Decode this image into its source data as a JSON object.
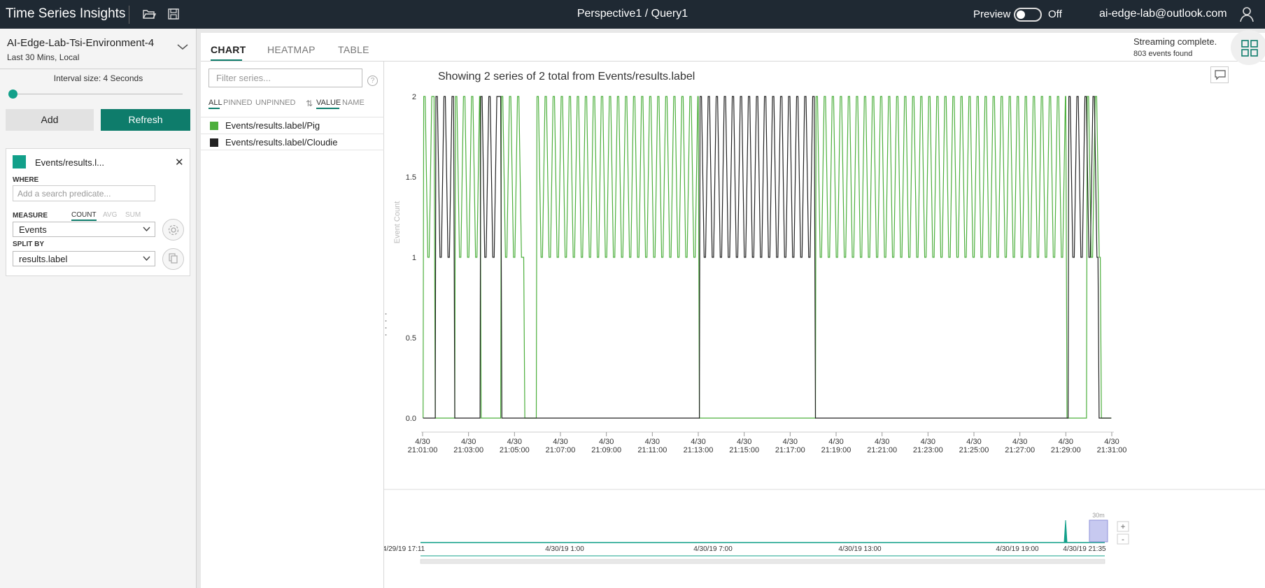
{
  "app": {
    "title": "Time Series Insights"
  },
  "header": {
    "breadcrumb": "Perspective1 / Query1",
    "preview_label": "Preview",
    "toggle_state": "Off",
    "user": "ai-edge-lab@outlook.com",
    "icons": [
      "folder-open-icon",
      "save-icon",
      "user-icon"
    ]
  },
  "left": {
    "environment": "AI-Edge-Lab-Tsi-Environment-4",
    "time_range": "Last 30 Mins, Local",
    "interval": "Interval size: 4 Seconds",
    "add_label": "Add",
    "refresh_label": "Refresh",
    "query": {
      "title": "Events/results.l...",
      "where_label": "WHERE",
      "predicate_placeholder": "Add a search predicate...",
      "measure_label": "MEASURE",
      "measure_tabs": [
        "COUNT",
        "AVG",
        "SUM"
      ],
      "measure_value": "Events",
      "splitby_label": "SPLIT BY",
      "splitby_value": "results.label",
      "color": "#12a08a"
    }
  },
  "main": {
    "tabs": [
      "CHART",
      "HEATMAP",
      "TABLE"
    ],
    "status": "Streaming complete.",
    "events_found": "803 events found",
    "filter_placeholder": "Filter series...",
    "help": "?",
    "filters": [
      "ALL",
      "PINNED",
      "UNPINNED"
    ],
    "sort": [
      "VALUE",
      "NAME"
    ],
    "series": [
      {
        "name": "Events/results.label/Pig",
        "color": "#4caf3c"
      },
      {
        "name": "Events/results.label/Cloudie",
        "color": "#222222"
      }
    ],
    "chart_title": "Showing 2 series of 2 total from Events/results.label"
  },
  "chart_data": {
    "type": "line",
    "ylabel": "Event Count",
    "y_ticks": [
      "2",
      "1.5",
      "1",
      "0.5",
      "0.0"
    ],
    "ylim": [
      0,
      2
    ],
    "x_ticks": [
      [
        "4/30",
        "21:01:00"
      ],
      [
        "4/30",
        "21:03:00"
      ],
      [
        "4/30",
        "21:05:00"
      ],
      [
        "4/30",
        "21:07:00"
      ],
      [
        "4/30",
        "21:09:00"
      ],
      [
        "4/30",
        "21:11:00"
      ],
      [
        "4/30",
        "21:13:00"
      ],
      [
        "4/30",
        "21:15:00"
      ],
      [
        "4/30",
        "21:17:00"
      ],
      [
        "4/30",
        "21:19:00"
      ],
      [
        "4/30",
        "21:21:00"
      ],
      [
        "4/30",
        "21:23:00"
      ],
      [
        "4/30",
        "21:25:00"
      ],
      [
        "4/30",
        "21:27:00"
      ],
      [
        "4/30",
        "21:29:00"
      ],
      [
        "4/30",
        "21:31:00"
      ]
    ],
    "xlim_minutes": [
      0,
      30
    ],
    "series": [
      {
        "name": "Events/results.label/Pig",
        "color": "#4caf3c",
        "active_spans_min": [
          [
            0.02,
            0.5
          ],
          [
            1.4,
            2.5
          ],
          [
            3.4,
            4.4
          ],
          [
            4.95,
            12.0
          ],
          [
            17.1,
            28.0
          ],
          [
            28.9,
            29.5
          ]
        ],
        "oscillation_period_min": 0.35
      },
      {
        "name": "Events/results.label/Cloudie",
        "color": "#222222",
        "active_spans_min": [
          [
            0.55,
            1.35
          ],
          [
            2.5,
            3.4
          ],
          [
            12.05,
            17.05
          ],
          [
            28.1,
            29.4
          ]
        ],
        "oscillation_period_min": 0.35
      }
    ],
    "overview": {
      "labels": [
        "4/29/19 17:11",
        "4/30/19 1:00",
        "4/30/19 7:00",
        "4/30/19 13:00",
        "4/30/19 19:00",
        "4/30/19 21:35"
      ],
      "window_label": "30m",
      "zoom_in": "+",
      "zoom_out": "-"
    }
  }
}
